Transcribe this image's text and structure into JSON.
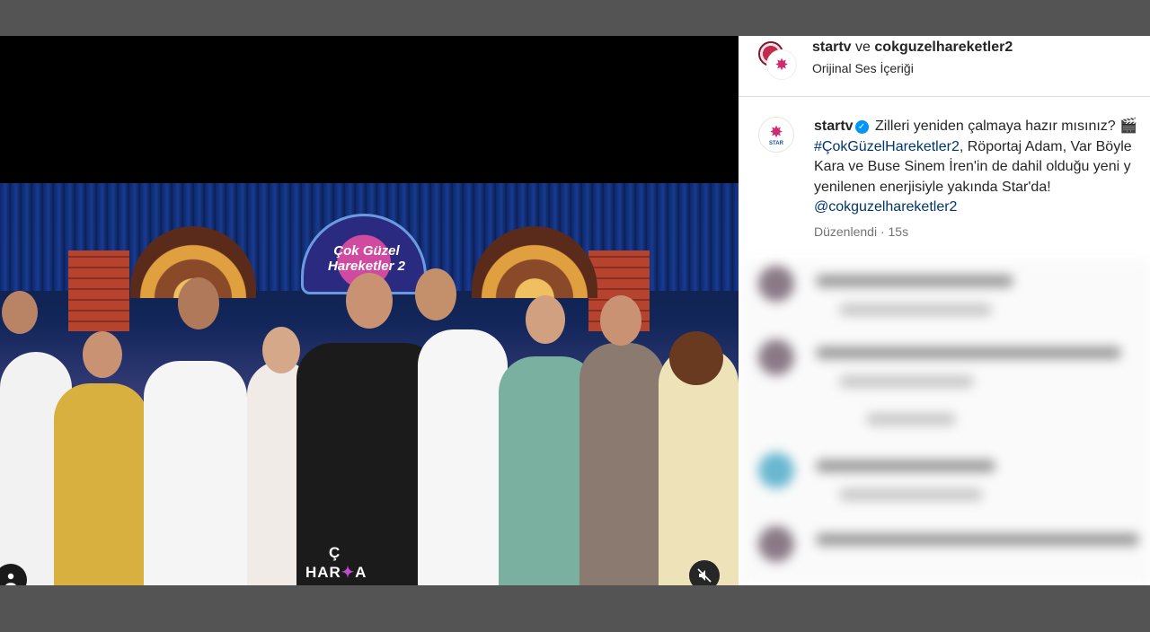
{
  "post": {
    "owner": "startv",
    "joiner": "ve",
    "collaborator": "cokguzelhareketler2",
    "audio_label": "Orijinal Ses İçeriği"
  },
  "caption": {
    "username": "startv",
    "line1": "Zilleri yeniden çalmaya hazır mısınız? 🎬",
    "hashtag": "#ÇokGüzelHareketler2",
    "line2_rest": ", Röportaj Adam, Var Böyle",
    "line3": "Kara ve Buse Sinem İren'in de dahil olduğu yeni y",
    "line4": "yenilenen enerjisiyle yakında Star'da!",
    "mention": "@cokguzelhareketler2",
    "edited": "Düzenlendi",
    "separator": " · ",
    "time": "15s"
  },
  "video": {
    "show_logo": "Çok Güzel Hareketler 2",
    "caption_overlay": "Ç",
    "caption_overlay2": "HAR",
    "caption_overlay3": "A",
    "muted": true
  },
  "icons": {
    "verified": "verified-badge-icon",
    "mute": "speaker-muted-icon",
    "tag_people": "person-icon"
  },
  "colors": {
    "link": "#00376b",
    "verified": "#0095f6",
    "muted_text": "#737373"
  }
}
